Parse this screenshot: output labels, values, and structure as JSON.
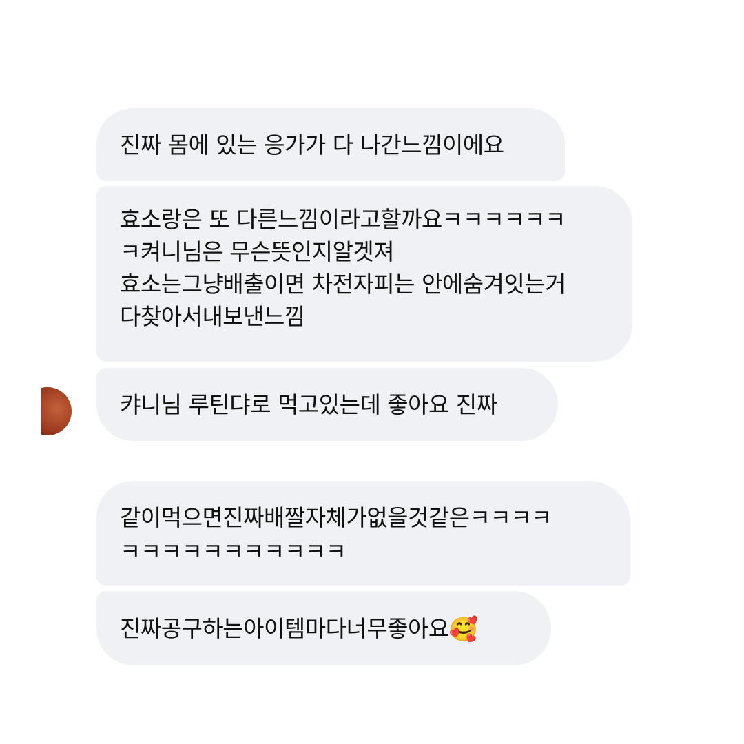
{
  "messages": [
    {
      "lines": [
        "진짜 몸에 있는 응가가 다 나간느낌이에요"
      ]
    },
    {
      "lines": [
        "효소랑은 또 다른느낌이라고할까요ㅋㅋㅋㅋㅋㅋ",
        "ㅋ켜니님은 무슨뜻인지알겟져",
        "효소는그냥배출이면 차전자피는 안에숨겨잇는거",
        "다찾아서내보낸느낌"
      ]
    },
    {
      "lines": [
        "캬니님 루틴댜로 먹고있는데 좋아요 진짜"
      ]
    },
    {
      "lines": [
        "같이먹으면진짜배짤자체가없을것같은ㅋㅋㅋㅋ",
        "ㅋㅋㅋㅋㅋㅋㅋㅋㅋㅋㅋ"
      ]
    },
    {
      "text": "진짜공구하는아이템마다너무좋아요",
      "emoji": "🥰"
    }
  ],
  "colors": {
    "bubble_bg": "#eff1f4",
    "text": "#111111",
    "background": "#ffffff"
  }
}
